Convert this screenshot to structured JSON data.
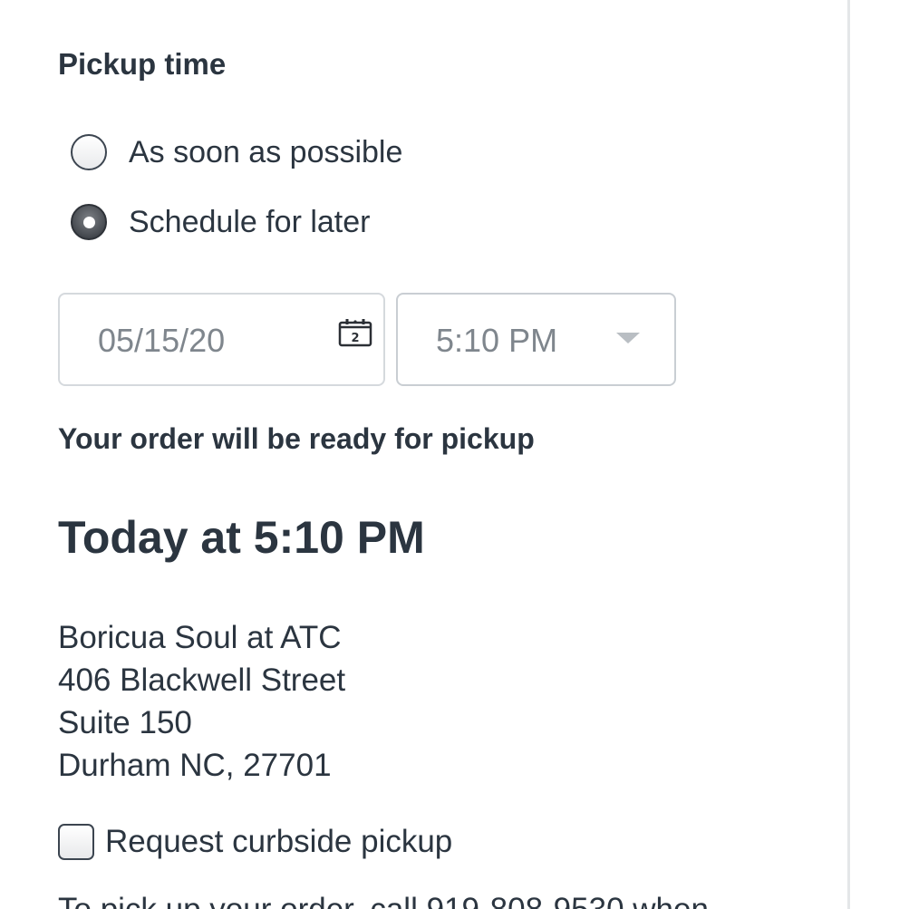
{
  "pickup": {
    "section_title": "Pickup time",
    "options": [
      {
        "label": "As soon as possible",
        "selected": false
      },
      {
        "label": "Schedule for later",
        "selected": true
      }
    ],
    "date": {
      "value": "05/15/20",
      "icon": "calendar-icon",
      "icon_day": "2"
    },
    "time": {
      "value": "5:10 PM",
      "icon": "chevron-down-icon"
    },
    "ready_label": "Your order will be ready for pickup",
    "ready_time": "Today at 5:10 PM"
  },
  "location": {
    "lines": [
      "Boricua Soul at ATC",
      "406 Blackwell Street",
      "Suite 150",
      "Durham NC, 27701"
    ]
  },
  "curbside": {
    "label": "Request curbside pickup",
    "checked": false
  },
  "footer": {
    "partial_text": "To pick up your order, call 919-808-9530 when"
  }
}
